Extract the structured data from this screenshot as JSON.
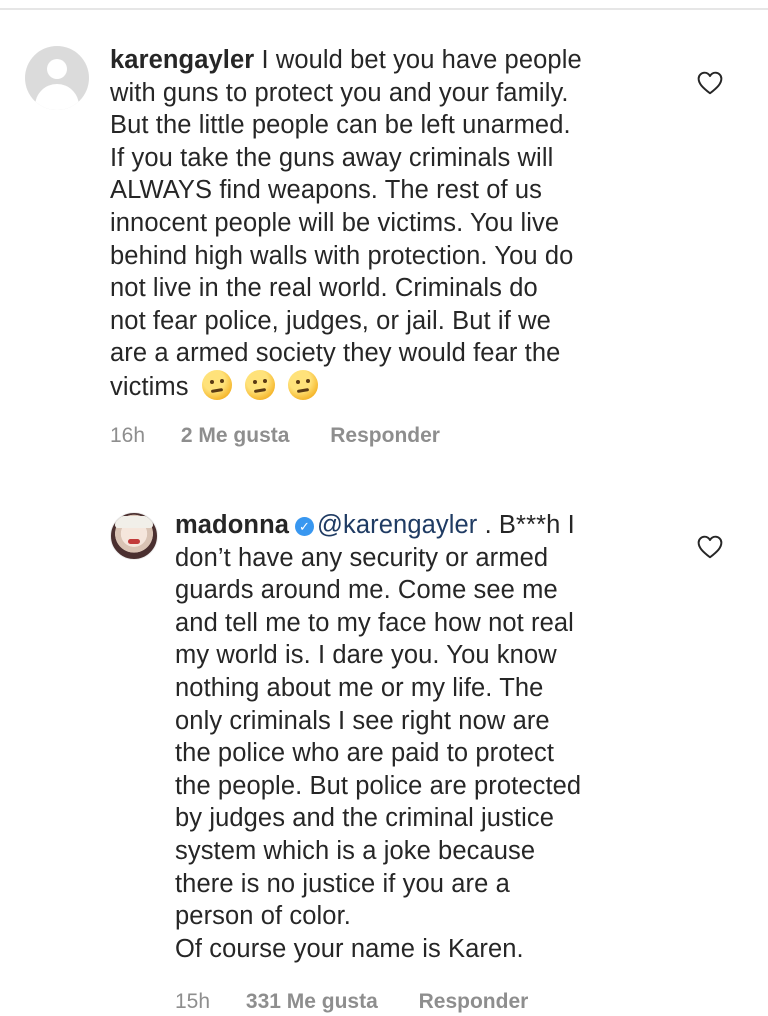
{
  "comments": [
    {
      "username": "karengayler",
      "lines": [
        "I would bet you have people",
        "with guns to protect you and your family.",
        "But the little people can be left unarmed.",
        "If you take the guns away criminals will",
        "ALWAYS find weapons. The rest of us",
        "innocent people will be victims. You live",
        "behind high walls with protection. You do",
        "not live in the real world.  Criminals do",
        "not fear police, judges, or jail. But if we",
        "are a armed society they would fear the",
        "victims"
      ],
      "emoji": [
        "thinking-face",
        "thinking-face",
        "thinking-face"
      ],
      "time": "16h",
      "likes": "2 Me gusta",
      "reply": "Responder",
      "avatar": "default-avatar"
    },
    {
      "username": "madonna",
      "verified": true,
      "mention": "@karengayler",
      "first_line_rest": ". B***h I",
      "lines": [
        "don’t have any security or armed",
        "guards around me. Come see me",
        "and tell me to my face how not real",
        "my world is. I dare you.  You know",
        "nothing about me or my life. The",
        "only criminals I see right now are",
        "the police who are paid to protect",
        "the people. But police are protected",
        "by judges and the criminal justice",
        "system which is a joke because",
        "there is no justice if you are a",
        "person of color.",
        "Of course your name is Karen."
      ],
      "time": "15h",
      "likes": "331 Me gusta",
      "reply": "Responder",
      "avatar": "profile-photo"
    }
  ],
  "colors": {
    "text": "#262626",
    "meta": "#8e8e8e",
    "mention": "#1f3b63",
    "verified": "#3897f0"
  },
  "icons": {
    "like": "heart-outline-icon",
    "verified": "verified-badge-icon"
  }
}
